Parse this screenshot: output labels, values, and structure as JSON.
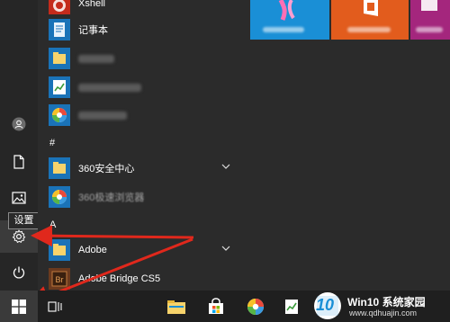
{
  "tooltip": {
    "text": "设置"
  },
  "apps": {
    "xshell": "Xshell",
    "notepad": "记事本",
    "section_hash": "#",
    "app_360": "360安全中心",
    "app_360b": "360极速浏览器",
    "section_a": "A",
    "adobe": "Adobe",
    "adobe_bridge": "Adobe Bridge CS5"
  },
  "watermark": {
    "logo": "10",
    "title": "Win10 系统家园",
    "url": "www.qdhuajin.com"
  },
  "colors": {
    "tile_orange": "#e25c1d",
    "tile_blue": "#1a8fd6",
    "tile_purple": "#a4267d",
    "folder_yellow": "#f7d36b",
    "accent_red": "#e0281c"
  },
  "icons": [
    "user-icon",
    "document-icon",
    "pictures-icon",
    "gear-icon",
    "power-icon",
    "windows-icon",
    "task-view-icon",
    "file-explorer-icon",
    "store-icon",
    "photos-icon",
    "app-icon",
    "chevron-down-icon"
  ]
}
